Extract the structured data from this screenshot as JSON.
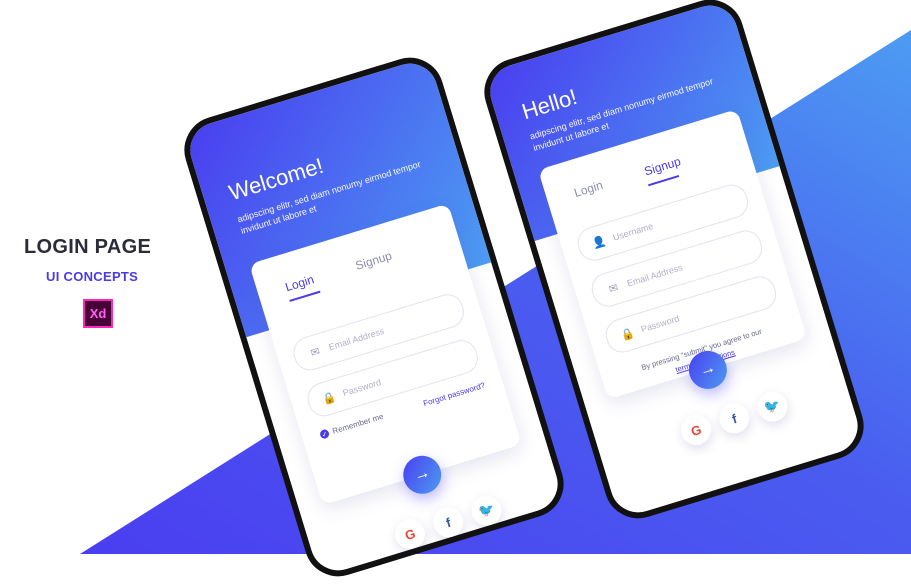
{
  "side": {
    "title": "LOGIN PAGE",
    "subtitle": "UI CONCEPTS",
    "logo_text": "Xd"
  },
  "phone_login": {
    "header_title": "Welcome!",
    "header_text": "adipscing elitr, sed diam nonumy eirmod tempor invidunt ut labore et",
    "tabs": [
      "Login",
      "Signup"
    ],
    "active_tab": "Login",
    "fields": [
      {
        "placeholder": "Email Address",
        "icon": "mail-icon"
      },
      {
        "placeholder": "Password",
        "icon": "lock-icon"
      }
    ],
    "remember_label": "Remember me",
    "forgot_label": "Forgot password?",
    "submit_icon": "arrow-right-icon",
    "socials": [
      "google-icon",
      "facebook-icon",
      "twitter-icon"
    ]
  },
  "phone_signup": {
    "header_title": "Hello!",
    "header_text": "adipscing elitr, sed diam nonumy eirmod tempor invidunt ut labore et",
    "tabs": [
      "Login",
      "Signup"
    ],
    "active_tab": "Signup",
    "fields": [
      {
        "placeholder": "Username",
        "icon": "user-icon"
      },
      {
        "placeholder": "Email Address",
        "icon": "mail-icon"
      },
      {
        "placeholder": "Password",
        "icon": "lock-icon"
      }
    ],
    "terms_text": "By pressing \"submit\" you agree to our",
    "terms_link": "terms & conditions",
    "submit_icon": "arrow-right-icon",
    "socials": [
      "google-icon",
      "facebook-icon",
      "twitter-icon"
    ]
  },
  "icons": {
    "google": "G",
    "facebook": "f",
    "twitter": "🐦",
    "arrow": "→"
  },
  "colors": {
    "accent": "#4a3be6",
    "gradient_start": "#4a3ef0",
    "gradient_end": "#4c9cf2"
  }
}
